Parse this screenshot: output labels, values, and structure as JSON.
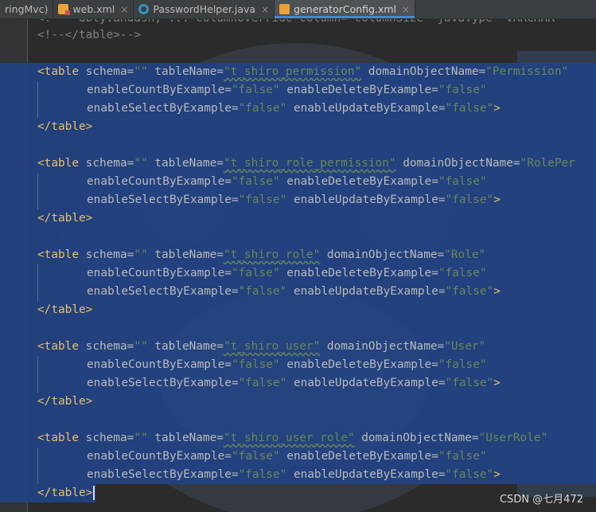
{
  "tabs": [
    {
      "label": "ringMvc)",
      "icon": "none",
      "active": false
    },
    {
      "label": "web.xml",
      "icon": "xml-file-icon",
      "active": false
    },
    {
      "label": "PasswordHelper.java",
      "icon": "java-class-icon",
      "active": false
    },
    {
      "label": "generatorConfig.xml",
      "icon": "xml-config-icon",
      "active": true
    }
  ],
  "tab_close_glyph": "×",
  "code": {
    "line_top_partial": "<!--  dbty.andash, ... columnOverride column= columnSize  javaType  VARCHAR",
    "line_comment_end": "<!--</table>-->",
    "blocks": [
      {
        "open": "<table",
        "schema_attr": "schema=",
        "schema_val": "\"\"",
        "table_attr": "tableName=",
        "table_val": "\"t_shiro_permission\"",
        "domain_attr": "domainObjectName=",
        "domain_val": "\"Permission\"",
        "count_attr": "enableCountByExample=",
        "count_val": "\"false\"",
        "delete_attr": "enableDeleteByExample=",
        "delete_val": "\"false\"",
        "select_attr": "enableSelectByExample=",
        "select_val": "\"false\"",
        "update_attr": "enableUpdateByExample=",
        "update_val": "\"false\"",
        "end_bracket": ">",
        "close": "</table>"
      },
      {
        "open": "<table",
        "schema_attr": "schema=",
        "schema_val": "\"\"",
        "table_attr": "tableName=",
        "table_val": "\"t_shiro_role_permission\"",
        "domain_attr": "domainObjectName=",
        "domain_val": "\"RolePer",
        "count_attr": "enableCountByExample=",
        "count_val": "\"false\"",
        "delete_attr": "enableDeleteByExample=",
        "delete_val": "\"false\"",
        "select_attr": "enableSelectByExample=",
        "select_val": "\"false\"",
        "update_attr": "enableUpdateByExample=",
        "update_val": "\"false\"",
        "end_bracket": ">",
        "close": "</table>"
      },
      {
        "open": "<table",
        "schema_attr": "schema=",
        "schema_val": "\"\"",
        "table_attr": "tableName=",
        "table_val": "\"t_shiro_role\"",
        "domain_attr": "domainObjectName=",
        "domain_val": "\"Role\"",
        "count_attr": "enableCountByExample=",
        "count_val": "\"false\"",
        "delete_attr": "enableDeleteByExample=",
        "delete_val": "\"false\"",
        "select_attr": "enableSelectByExample=",
        "select_val": "\"false\"",
        "update_attr": "enableUpdateByExample=",
        "update_val": "\"false\"",
        "end_bracket": ">",
        "close": "</table>"
      },
      {
        "open": "<table",
        "schema_attr": "schema=",
        "schema_val": "\"\"",
        "table_attr": "tableName=",
        "table_val": "\"t_shiro_user\"",
        "domain_attr": "domainObjectName=",
        "domain_val": "\"User\"",
        "count_attr": "enableCountByExample=",
        "count_val": "\"false\"",
        "delete_attr": "enableDeleteByExample=",
        "delete_val": "\"false\"",
        "select_attr": "enableSelectByExample=",
        "select_val": "\"false\"",
        "update_attr": "enableUpdateByExample=",
        "update_val": "\"false\"",
        "end_bracket": ">",
        "close": "</table>"
      },
      {
        "open": "<table",
        "schema_attr": "schema=",
        "schema_val": "\"\"",
        "table_attr": "tableName=",
        "table_val": "\"t_shiro_user_role\"",
        "domain_attr": "domainObjectName=",
        "domain_val": "\"UserRole\"",
        "count_attr": "enableCountByExample=",
        "count_val": "\"false\"",
        "delete_attr": "enableDeleteByExample=",
        "delete_val": "\"false\"",
        "select_attr": "enableSelectByExample=",
        "select_val": "\"false\"",
        "update_attr": "enableUpdateByExample=",
        "update_val": "\"false\"",
        "end_bracket": ">",
        "close": "</table>"
      }
    ]
  },
  "watermark": "CSDN @七月472",
  "colors": {
    "editor_bg": "#2b2b2b",
    "selection": "#214283",
    "tag": "#e8bf6a",
    "attribute": "#bababa",
    "value": "#6a8759",
    "comment": "#808080"
  }
}
